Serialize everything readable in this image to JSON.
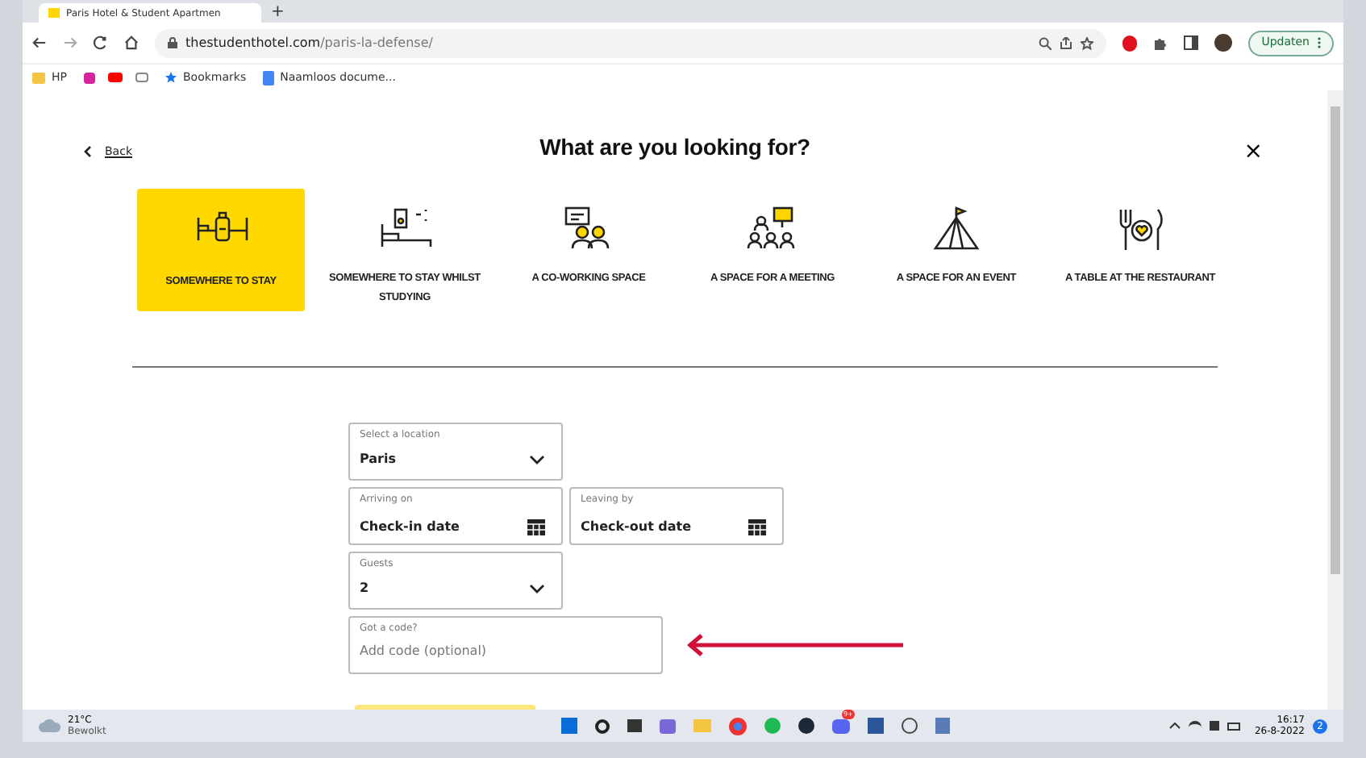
{
  "browser": {
    "tab_title": "Paris Hotel & Student Apartmen",
    "new_tab": "+",
    "url_domain": "thestudenthotel.com",
    "url_path": "/paris-la-defense/",
    "update_button": "Updaten",
    "bookmarks": [
      {
        "kind": "folder",
        "label": "HP"
      },
      {
        "kind": "star",
        "label": "Bookmarks"
      },
      {
        "kind": "doc",
        "label": "Naamloos docume..."
      }
    ]
  },
  "page": {
    "back": "Back",
    "title": "What are you looking for?",
    "close": "×",
    "categories": [
      {
        "kind": "stay",
        "label": "SOMEWHERE TO STAY",
        "selected": true
      },
      {
        "kind": "study",
        "label": "SOMEWHERE TO STAY WHILST STUDYING",
        "selected": false
      },
      {
        "kind": "cowork",
        "label": "A CO-WORKING SPACE",
        "selected": false
      },
      {
        "kind": "meeting",
        "label": "A SPACE FOR A MEETING",
        "selected": false
      },
      {
        "kind": "event",
        "label": "A SPACE FOR AN EVENT",
        "selected": false
      },
      {
        "kind": "restaurant",
        "label": "A TABLE AT THE RESTAURANT",
        "selected": false
      }
    ],
    "form": [
      [
        {
          "kind": "select",
          "label": "Select a location",
          "value": "Paris"
        }
      ],
      [
        {
          "kind": "date",
          "label": "Arriving on",
          "value": "Check-in date"
        },
        {
          "kind": "date",
          "label": "Leaving by",
          "value": "Check-out date"
        }
      ],
      [
        {
          "kind": "select",
          "label": "Guests",
          "value": "2"
        }
      ],
      [
        {
          "kind": "text",
          "label": "Got a code?",
          "placeholder": "Add code (optional)"
        }
      ]
    ]
  },
  "taskbar": {
    "temperature": "21°C",
    "weather": "Bewolkt",
    "app_badge": "9+",
    "time": "16:17",
    "date": "26-8-2022",
    "notifications": "2"
  }
}
